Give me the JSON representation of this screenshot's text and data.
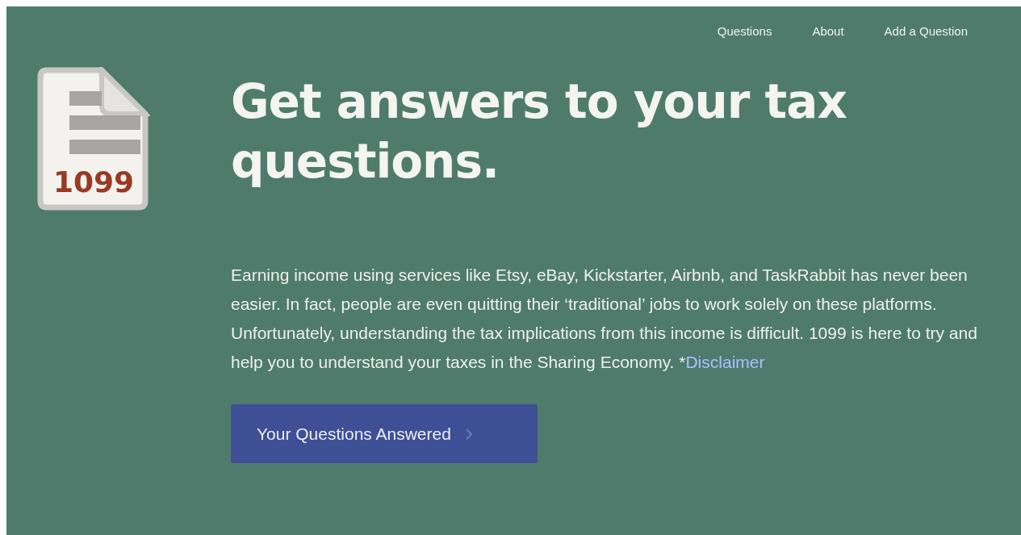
{
  "nav": [
    {
      "label": "Questions"
    },
    {
      "label": "About"
    },
    {
      "label": "Add a Question"
    }
  ],
  "logo": {
    "label": "1099"
  },
  "headline": "Get answers to your tax questions.",
  "intro": {
    "text": "Earning income using services like Etsy, eBay, Kickstarter, Airbnb, and TaskRabbit has never been easier. In fact, people are even quitting their ‘traditional’ jobs to work solely on these platforms. Unfortunately, understanding the tax implications from this income is difficult. 1099 is here to try and help you to understand your taxes in the Sharing Economy. *",
    "link": "Disclaimer"
  },
  "cta": {
    "label": "Your Questions Answered"
  }
}
